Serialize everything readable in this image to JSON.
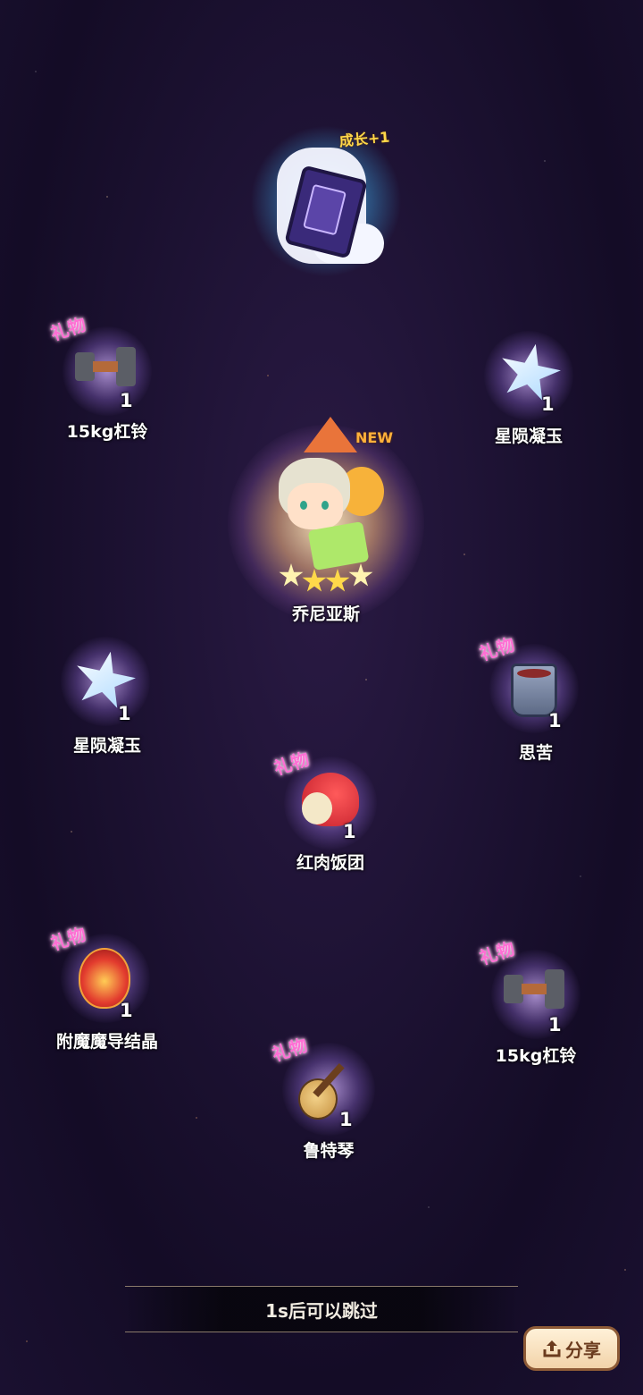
{
  "top_card": {
    "badge": "成长+1",
    "icon": "growth-card-icon"
  },
  "hero": {
    "name": "乔尼亚斯",
    "new_label": "NEW",
    "stars": 4
  },
  "gift_tag": "礼物",
  "items": {
    "dumbbell_left": {
      "label": "15kg杠铃",
      "count": "1"
    },
    "star_jade_right": {
      "label": "星陨凝玉",
      "count": "1"
    },
    "star_jade_left": {
      "label": "星陨凝玉",
      "count": "1"
    },
    "bitter_cup": {
      "label": "思苦",
      "count": "1"
    },
    "rice_ball": {
      "label": "红肉饭团",
      "count": "1"
    },
    "crystal": {
      "label": "附魔魔导结晶",
      "count": "1"
    },
    "dumbbell_right": {
      "label": "15kg杠铃",
      "count": "1"
    },
    "lute": {
      "label": "鲁特琴",
      "count": "1"
    }
  },
  "skip_text": "1s后可以跳过",
  "share_label": "分享"
}
